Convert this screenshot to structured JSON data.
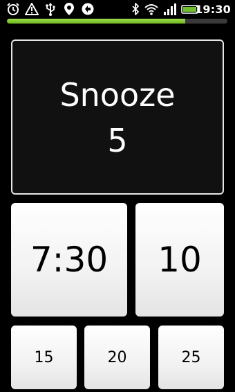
{
  "status_bar": {
    "time": "19:30",
    "battery_color": "#6fbf2f"
  },
  "progress": {
    "fraction": 0.81,
    "fill_color": "#8cd03a"
  },
  "snooze": {
    "label": "Snooze",
    "value": "5"
  },
  "options": {
    "large": [
      "7:30",
      "10"
    ],
    "small": [
      "15",
      "20",
      "25"
    ]
  }
}
